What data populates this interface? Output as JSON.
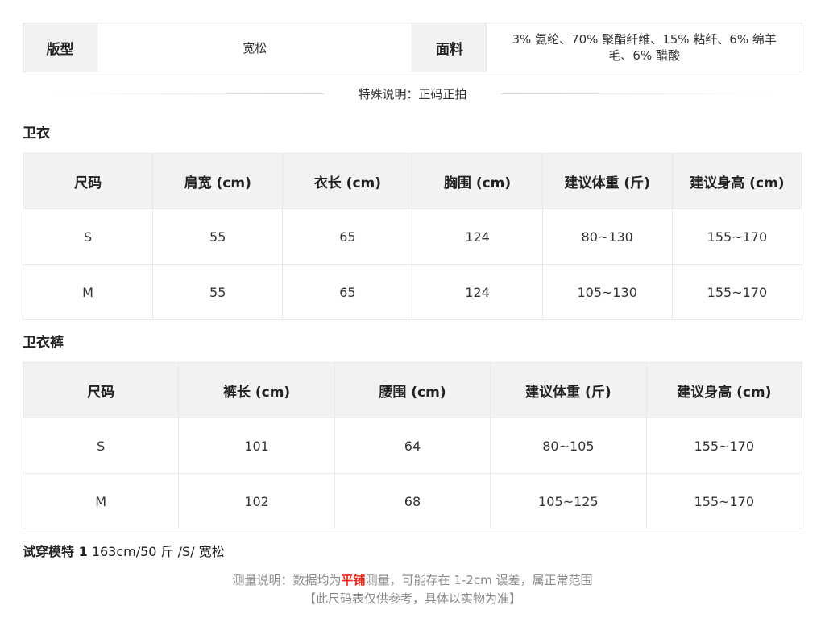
{
  "attributes": {
    "fit_label": "版型",
    "fit_value": "宽松",
    "fabric_label": "面料",
    "fabric_value": "3% 氨纶、70% 聚酯纤维、15% 粘纤、6% 绵羊毛、6% 醋酸"
  },
  "special_note": "特殊说明：正码正拍",
  "hoodie": {
    "title": "卫衣",
    "headers": [
      "尺码",
      "肩宽 (cm)",
      "衣长 (cm)",
      "胸围 (cm)",
      "建议体重 (斤)",
      "建议身高 (cm)"
    ],
    "rows": [
      [
        "S",
        "55",
        "65",
        "124",
        "80~130",
        "155~170"
      ],
      [
        "M",
        "55",
        "65",
        "124",
        "105~130",
        "155~170"
      ]
    ]
  },
  "pants": {
    "title": "卫衣裤",
    "headers": [
      "尺码",
      "裤长 (cm)",
      "腰围 (cm)",
      "建议体重 (斤)",
      "建议身高 (cm)"
    ],
    "rows": [
      [
        "S",
        "101",
        "64",
        "80~105",
        "155~170"
      ],
      [
        "M",
        "102",
        "68",
        "105~125",
        "155~170"
      ]
    ]
  },
  "model": {
    "label": "试穿模特 1",
    "value": "163cm/50 斤 /S/ 宽松"
  },
  "footer": {
    "line1_prefix": "测量说明：数据均为",
    "line1_highlight": "平铺",
    "line1_suffix": "测量，可能存在 1-2cm 误差，属正常范围",
    "line2": "【此尺码表仅供参考，具体以实物为准】"
  },
  "colors": {
    "header_bg": "#f2f2f2",
    "border": "#e8e8e8",
    "highlight": "#e8291c",
    "muted_text": "#8a8a8a"
  }
}
